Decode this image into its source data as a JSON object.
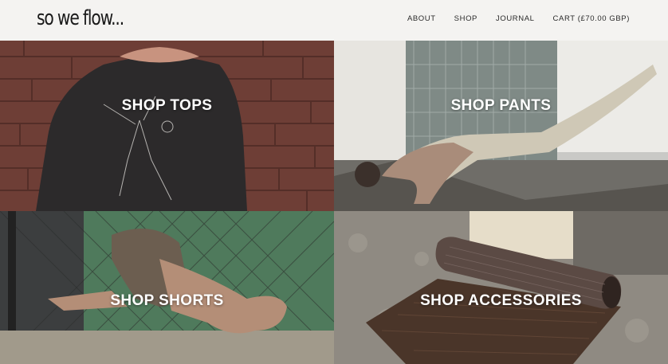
{
  "header": {
    "logo": "so we flow...",
    "nav": {
      "about": "ABOUT",
      "shop": "SHOP",
      "journal": "JOURNAL",
      "cart": "CART (£70.00 GBP)"
    }
  },
  "collections": {
    "tops": "SHOP TOPS",
    "pants": "SHOP PANTS",
    "shorts": "SHOP SHORTS",
    "accessories": "SHOP ACCESSORIES"
  },
  "colors": {
    "header_bg": "#f4f3f1",
    "text": "#1a1a1a",
    "label": "#ffffff"
  }
}
